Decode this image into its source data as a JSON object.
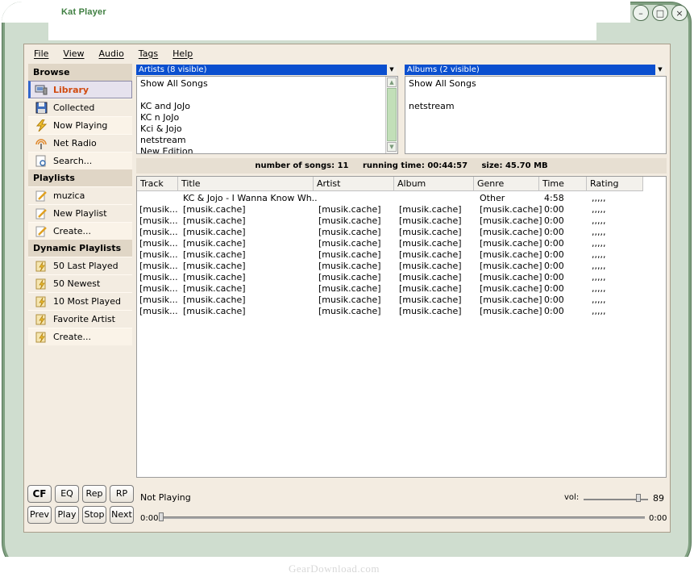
{
  "window": {
    "title": "Kat Player",
    "controls": [
      "–",
      "□",
      "×"
    ]
  },
  "menu": [
    "File",
    "View",
    "Audio",
    "Tags",
    "Help"
  ],
  "sidebar": {
    "browse_header": "Browse",
    "browse": [
      {
        "label": "Library",
        "icon": "library-icon"
      },
      {
        "label": "Collected",
        "icon": "disk-icon"
      },
      {
        "label": "Now Playing",
        "icon": "lightning-icon"
      },
      {
        "label": "Net Radio",
        "icon": "radio-icon"
      },
      {
        "label": "Search...",
        "icon": "search-icon"
      }
    ],
    "playlists_header": "Playlists",
    "playlists": [
      {
        "label": "muzica",
        "icon": "pencil-icon"
      },
      {
        "label": "New Playlist",
        "icon": "pencil-icon"
      },
      {
        "label": "Create...",
        "icon": "pencil-icon"
      }
    ],
    "dynamic_header": "Dynamic Playlists",
    "dynamic": [
      {
        "label": "50 Last Played",
        "icon": "dynamic-playlist-icon"
      },
      {
        "label": "50 Newest",
        "icon": "dynamic-playlist-icon"
      },
      {
        "label": "10 Most Played",
        "icon": "dynamic-playlist-icon"
      },
      {
        "label": "Favorite Artist",
        "icon": "dynamic-playlist-icon"
      },
      {
        "label": "Create...",
        "icon": "dynamic-playlist-icon"
      }
    ]
  },
  "artists": {
    "header": "Artists (8 visible)",
    "items": [
      "Show All Songs",
      "",
      "KC and JoJo",
      "KC n JoJo",
      "Kci & Jojo",
      "netstream",
      "New Edition"
    ]
  },
  "albums": {
    "header": "Albums (2 visible)",
    "items": [
      "Show All Songs",
      "",
      "netstream"
    ]
  },
  "stats": {
    "songs_label": "number of songs:",
    "songs": "11",
    "time_label": "running time:",
    "time": "00:44:57",
    "size_label": "size:",
    "size": "45.70 MB"
  },
  "table": {
    "columns": [
      "Track",
      "Title",
      "Artist",
      "Album",
      "Genre",
      "Time",
      "Rating"
    ],
    "rows": [
      [
        "",
        "KC & Jojo - I Wanna Know Wh...",
        "",
        "",
        "Other",
        "4:58",
        ",,,,,"
      ],
      [
        "[musik...",
        "[musik.cache]",
        "[musik.cache]",
        "[musik.cache]",
        "[musik.cache]",
        "0:00",
        ",,,,,"
      ],
      [
        "[musik...",
        "[musik.cache]",
        "[musik.cache]",
        "[musik.cache]",
        "[musik.cache]",
        "0:00",
        ",,,,,"
      ],
      [
        "[musik...",
        "[musik.cache]",
        "[musik.cache]",
        "[musik.cache]",
        "[musik.cache]",
        "0:00",
        ",,,,,"
      ],
      [
        "[musik...",
        "[musik.cache]",
        "[musik.cache]",
        "[musik.cache]",
        "[musik.cache]",
        "0:00",
        ",,,,,"
      ],
      [
        "[musik...",
        "[musik.cache]",
        "[musik.cache]",
        "[musik.cache]",
        "[musik.cache]",
        "0:00",
        ",,,,,"
      ],
      [
        "[musik...",
        "[musik.cache]",
        "[musik.cache]",
        "[musik.cache]",
        "[musik.cache]",
        "0:00",
        ",,,,,"
      ],
      [
        "[musik...",
        "[musik.cache]",
        "[musik.cache]",
        "[musik.cache]",
        "[musik.cache]",
        "0:00",
        ",,,,,"
      ],
      [
        "[musik...",
        "[musik.cache]",
        "[musik.cache]",
        "[musik.cache]",
        "[musik.cache]",
        "0:00",
        ",,,,,"
      ],
      [
        "[musik...",
        "[musik.cache]",
        "[musik.cache]",
        "[musik.cache]",
        "[musik.cache]",
        "0:00",
        ",,,,,"
      ],
      [
        "[musik...",
        "[musik.cache]",
        "[musik.cache]",
        "[musik.cache]",
        "[musik.cache]",
        "0:00",
        ",,,,,"
      ]
    ]
  },
  "player": {
    "buttons_top": [
      "CF",
      "EQ",
      "Rep",
      "RP"
    ],
    "buttons_bottom": [
      "Prev",
      "Play",
      "Stop",
      "Next"
    ],
    "status": "Not Playing",
    "volume_label": "vol:",
    "volume": "89",
    "elapsed": "0:00",
    "total": "0:00"
  },
  "watermark": "GearDownload.com",
  "colors": {
    "accent": "#d14b10",
    "selection": "#0a4fcf",
    "skin": "#7f9f80",
    "panel": "#f3ece1"
  }
}
